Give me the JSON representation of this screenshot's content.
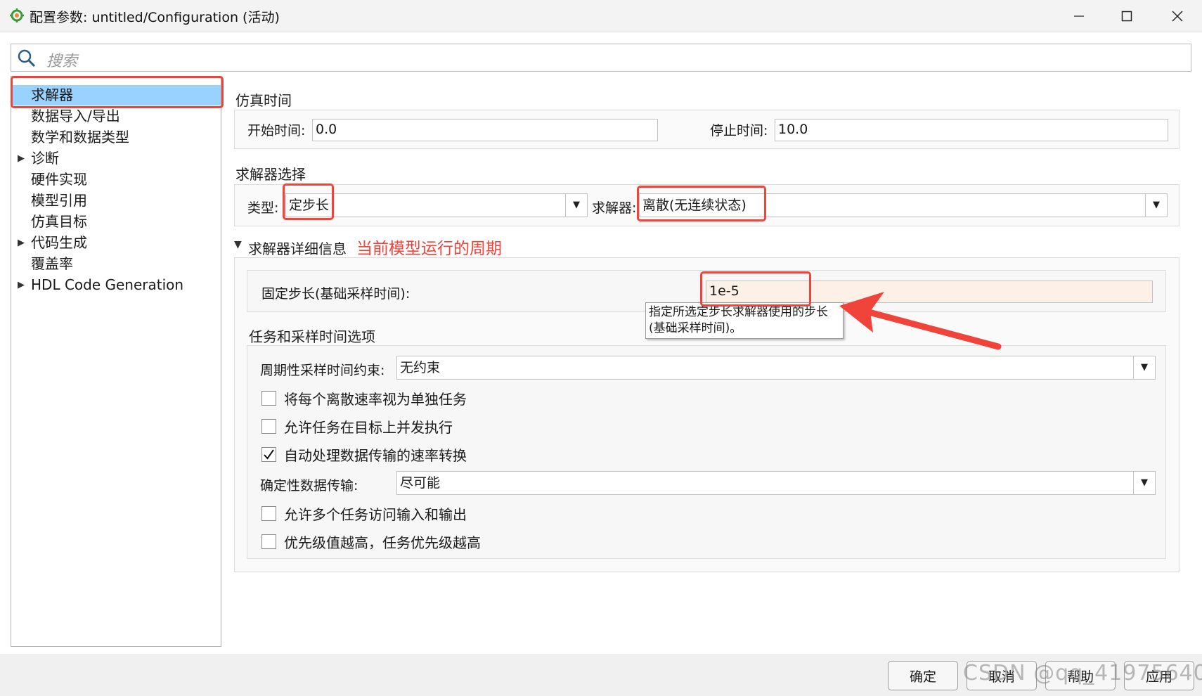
{
  "window": {
    "title": "配置参数: untitled/Configuration (活动)",
    "app_icon": "simulink-gear-icon",
    "buttons": [
      "minimize-icon",
      "maximize-icon",
      "close-icon"
    ]
  },
  "search": {
    "placeholder": "搜索"
  },
  "tree": {
    "items": [
      {
        "label": "求解器",
        "expandable": false,
        "selected": true
      },
      {
        "label": "数据导入/导出",
        "expandable": false
      },
      {
        "label": "数学和数据类型",
        "expandable": false
      },
      {
        "label": "诊断",
        "expandable": true
      },
      {
        "label": "硬件实现",
        "expandable": false
      },
      {
        "label": "模型引用",
        "expandable": false
      },
      {
        "label": "仿真目标",
        "expandable": false
      },
      {
        "label": "代码生成",
        "expandable": true
      },
      {
        "label": "覆盖率",
        "expandable": false
      },
      {
        "label": "HDL Code Generation",
        "expandable": true
      }
    ]
  },
  "sim_time": {
    "section_title": "仿真时间",
    "start_label": "开始时间:",
    "start_value": "0.0",
    "stop_label": "停止时间:",
    "stop_value": "10.0"
  },
  "solver_select": {
    "section_title": "求解器选择",
    "type_label": "类型:",
    "type_value": "定步长",
    "solver_label": "求解器:",
    "solver_value": "离散(无连续状态)"
  },
  "solver_details": {
    "section_title": "求解器详细信息",
    "annotation": "当前模型运行的周期",
    "fixed_step_label": "固定步长(基础采样时间):",
    "fixed_step_value": "1e-5",
    "tooltip_line1": "指定所选定步长求解器使用的步长",
    "tooltip_line2": "(基础采样时间)。"
  },
  "tasks": {
    "section_title": "任务和采样时间选项",
    "periodic_label": "周期性采样时间约束:",
    "periodic_value": "无约束",
    "checkbox1": {
      "label": "将每个离散速率视为单独任务",
      "checked": false
    },
    "checkbox2": {
      "label": "允许任务在目标上并发执行",
      "checked": false
    },
    "checkbox3": {
      "label": "自动处理数据传输的速率转换",
      "checked": true
    },
    "deterministic_label": "确定性数据传输:",
    "deterministic_value": "尽可能",
    "checkbox4": {
      "label": "允许多个任务访问输入和输出",
      "checked": false
    },
    "checkbox5": {
      "label": "优先级值越高，任务优先级越高",
      "checked": false
    }
  },
  "footer": {
    "ok": "确定",
    "cancel": "取消",
    "help": "帮助",
    "apply": "应用",
    "watermark": "CSDN @qq_41975640"
  },
  "colors": {
    "selection": "#99d1ff",
    "annotation_red": "#f0433a",
    "highlight_field": "#fdf0e6"
  }
}
